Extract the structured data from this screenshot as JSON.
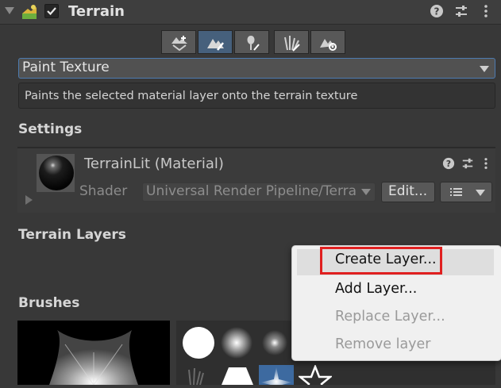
{
  "header": {
    "title": "Terrain",
    "enabled": true
  },
  "toolbar": {
    "tools": [
      {
        "icon": "create-neighbor-terrains-icon",
        "selected": false
      },
      {
        "icon": "paint-terrain-icon",
        "selected": true
      },
      {
        "icon": "paint-trees-icon",
        "selected": false
      },
      {
        "icon": "paint-details-icon",
        "selected": false
      },
      {
        "icon": "terrain-settings-icon",
        "selected": false
      }
    ]
  },
  "tool_select": {
    "value": "Paint Texture"
  },
  "tool_description": "Paints the selected material layer onto the terrain texture",
  "settings": {
    "heading": "Settings",
    "material_name": "TerrainLit (Material)",
    "shader_label": "Shader",
    "shader_value": "Universal Render Pipeline/Terrain/Lit",
    "edit_label": "Edit..."
  },
  "terrain_layers": {
    "heading": "Terrain Layers"
  },
  "brushes": {
    "heading": "Brushes"
  },
  "context_menu": {
    "items": [
      {
        "label": "Create Layer...",
        "enabled": true,
        "highlighted": true
      },
      {
        "label": "Add Layer...",
        "enabled": true
      },
      {
        "label": "Replace Layer...",
        "enabled": false
      },
      {
        "label": "Remove layer",
        "enabled": false
      }
    ]
  },
  "colors": {
    "accent": "#46607c",
    "focus_border": "#4d7bb0",
    "annotation_red": "#e02020",
    "panel_bg": "#383838"
  }
}
